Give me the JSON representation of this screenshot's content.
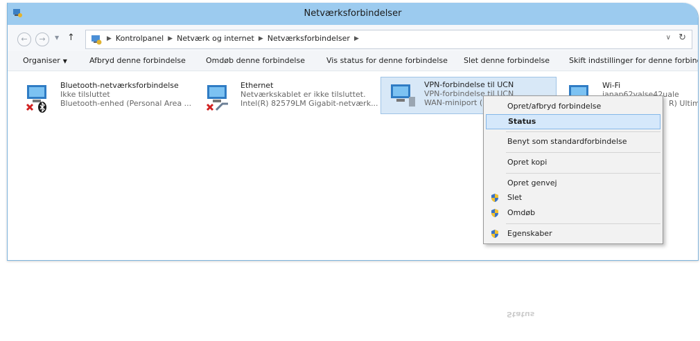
{
  "window": {
    "title": "Netværksforbindelser"
  },
  "nav": {
    "back_icon": "arrow-left-icon",
    "forward_icon": "arrow-right-icon",
    "recent_icon": "chevron-down-icon",
    "up_icon": "arrow-up-icon",
    "breadcrumbs": [
      "Kontrolpanel",
      "Netværk og internet",
      "Netværksforbindelser"
    ],
    "refresh_icon": "refresh-icon"
  },
  "toolbar": {
    "items": [
      "Organiser",
      "Afbryd denne forbindelse",
      "Omdøb denne forbindelse",
      "Vis status for denne forbindelse",
      "Slet denne forbindelse",
      "Skift indstillinger for denne forbindelse"
    ]
  },
  "connections": [
    {
      "name": "Bluetooth-netværksforbindelse",
      "status": "Ikke tilsluttet",
      "device": "Bluetooth-enhed (Personal Area ..."
    },
    {
      "name": "Ethernet",
      "status": "Netværkskablet er ikke tilsluttet.",
      "device": "Intel(R) 82579LM Gigabit-netværk..."
    },
    {
      "name": "VPN-forbindelse til UCN",
      "status": "VPN-forbindelse til UCN",
      "device": "WAN-miniport (P"
    },
    {
      "name": "Wi-Fi",
      "status": "janap62valse42uale",
      "device": "R) Ultima"
    }
  ],
  "context_menu": {
    "items": [
      {
        "label": "Opret/afbryd forbindelse",
        "shield": false
      },
      {
        "label": "Status",
        "shield": false,
        "highlighted": true
      },
      {
        "label": "Benyt som standardforbindelse",
        "shield": false
      },
      {
        "label": "Opret kopi",
        "shield": false
      },
      {
        "label": "Opret genvej",
        "shield": false
      },
      {
        "label": "Slet",
        "shield": true
      },
      {
        "label": "Omdøb",
        "shield": true
      },
      {
        "label": "Egenskaber",
        "shield": true
      }
    ]
  },
  "colors": {
    "titlebar": "#9ccbef",
    "selection": "#d8e8f7",
    "menu_highlight": "#d5e8fb"
  }
}
